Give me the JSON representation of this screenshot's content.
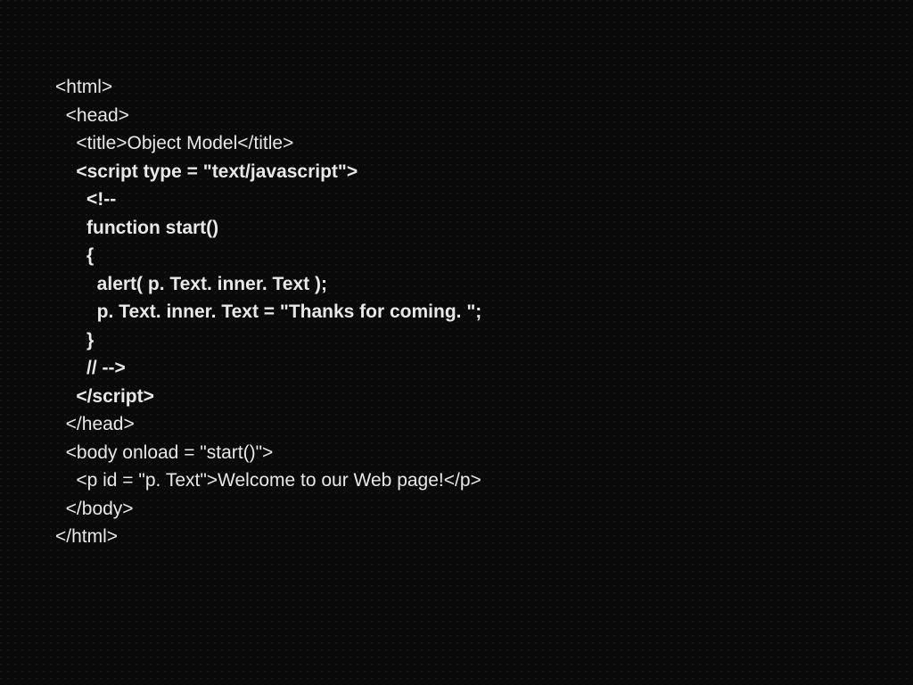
{
  "lines": {
    "l1": "<html>",
    "l2": "  <head>",
    "l3": "    <title>Object Model</title>",
    "l4": "",
    "l5": "    <script type = \"text/javascript\">",
    "l6": "      <!--",
    "l7": "      function start()",
    "l8": "      {",
    "l9": "        alert( p. Text. inner. Text );",
    "l10": "        p. Text. inner. Text = \"Thanks for coming. \";",
    "l11": "      }",
    "l12": "      // -->",
    "l13": "    </script>",
    "l14": "",
    "l15": "  </head>",
    "l16": "",
    "l17": "  <body onload = \"start()\">",
    "l18": "    <p id = \"p. Text\">Welcome to our Web page!</p>",
    "l19": "  </body>",
    "l20": "</html>"
  }
}
